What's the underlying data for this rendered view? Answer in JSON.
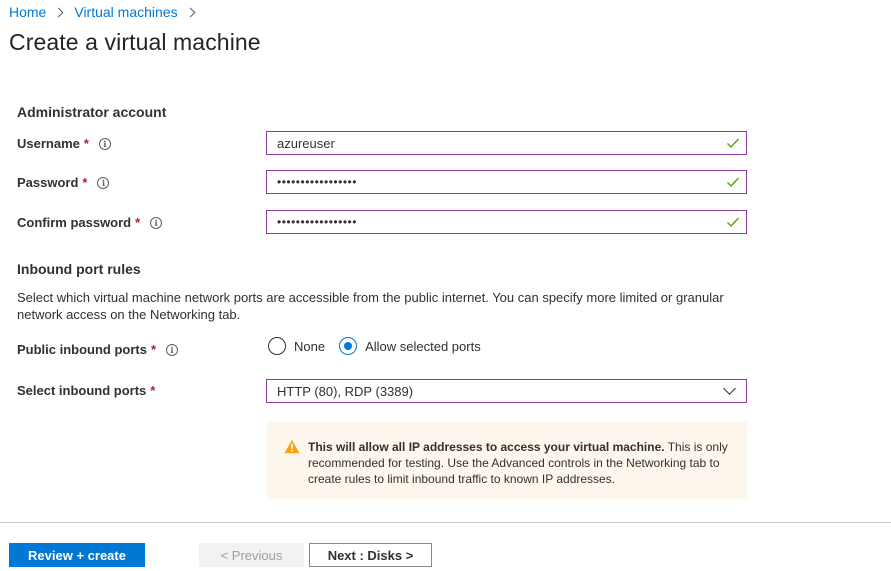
{
  "breadcrumb": {
    "home": "Home",
    "vms": "Virtual machines"
  },
  "page": {
    "title": "Create a virtual machine"
  },
  "admin": {
    "section_title": "Administrator account",
    "username_label": "Username",
    "username_value": "azureuser",
    "password_label": "Password",
    "password_value": "•••••••••••••••••",
    "confirm_label": "Confirm password",
    "confirm_value": "•••••••••••••••••",
    "required_mark": "*",
    "info_glyph": "i"
  },
  "inbound": {
    "section_title": "Inbound port rules",
    "description": "Select which virtual machine network ports are accessible from the public internet. You can specify more limited or granular network access on the Networking tab.",
    "public_ports_label": "Public inbound ports",
    "radio_none": "None",
    "radio_allow": "Allow selected ports",
    "selected_radio": "allow",
    "select_ports_label": "Select inbound ports",
    "select_ports_value": "HTTP (80), RDP (3389)"
  },
  "warning": {
    "bold": "This will allow all IP addresses to access your virtual machine.",
    "text": " This is only recommended for testing.  Use the Advanced controls in the Networking tab to create rules to limit inbound traffic to known IP addresses."
  },
  "footer": {
    "review_create": "Review + create",
    "previous": "< Previous",
    "next": "Next : Disks >"
  },
  "colors": {
    "accent": "#0078d4",
    "input_border": "#8a3d9c",
    "check": "#57a300",
    "required": "#a4262c",
    "warning_bg": "#fdf6ed",
    "warning_icon": "#f7a30a"
  }
}
